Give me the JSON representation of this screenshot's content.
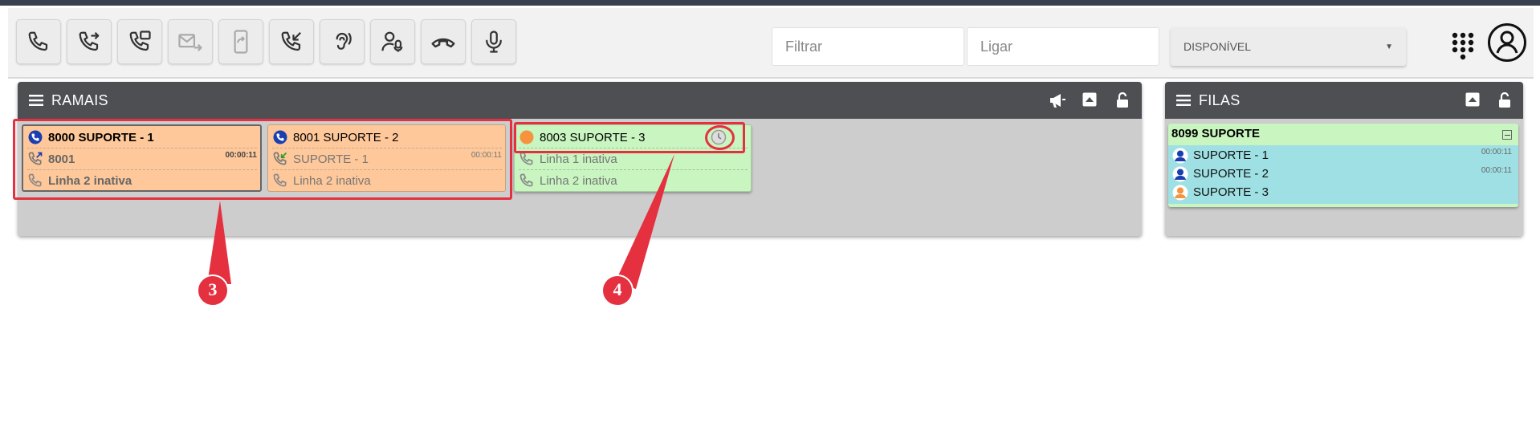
{
  "toolbar": {
    "buttons": [
      {
        "name": "call-button",
        "icon": "phone-icon",
        "state": "enabled"
      },
      {
        "name": "transfer-button",
        "icon": "phone-forward-icon",
        "state": "enabled"
      },
      {
        "name": "attended-transfer-button",
        "icon": "phone-voicemail-icon",
        "state": "enabled"
      },
      {
        "name": "forward-to-email-button",
        "icon": "mail-forward-icon",
        "state": "disabled"
      },
      {
        "name": "forward-to-mobile-button",
        "icon": "mobile-forward-icon",
        "state": "disabled"
      },
      {
        "name": "pickup-button",
        "icon": "phone-incoming-icon",
        "state": "enabled"
      },
      {
        "name": "listen-button",
        "icon": "ear-icon",
        "state": "enabled"
      },
      {
        "name": "whisper-button",
        "icon": "user-voice-icon",
        "state": "enabled"
      },
      {
        "name": "hangup-button",
        "icon": "phone-hangup-icon",
        "state": "enabled"
      },
      {
        "name": "microphone-button",
        "icon": "microphone-icon",
        "state": "enabled"
      }
    ],
    "filter_placeholder": "Filtrar",
    "dial_placeholder": "Ligar",
    "status_value": "DISPONÍVEL"
  },
  "ramais": {
    "title": "RAMAIS",
    "cards": [
      {
        "title": "8000 SUPORTE - 1",
        "status": "on-call",
        "line1": {
          "text": "8001",
          "time": "00:00:11",
          "icon": "phone-outgoing-icon"
        },
        "line2": {
          "text": "Linha 2 inativa",
          "icon": "phone-icon"
        }
      },
      {
        "title": "8001 SUPORTE - 2",
        "status": "on-call",
        "line1": {
          "text": "SUPORTE - 1",
          "time": "00:00:11",
          "icon": "phone-incoming-icon"
        },
        "line2": {
          "text": "Linha 2 inativa",
          "icon": "phone-icon"
        }
      },
      {
        "title": "8003 SUPORTE - 3",
        "status": "paused",
        "line1": {
          "text": "Linha 1 inativa",
          "icon": "phone-icon"
        },
        "line2": {
          "text": "Linha 2 inativa",
          "icon": "phone-icon"
        }
      }
    ]
  },
  "filas": {
    "title": "FILAS",
    "queue": {
      "title": "8099 SUPORTE",
      "members": [
        {
          "name": "SUPORTE - 1",
          "time": "00:00:11",
          "status": "busy"
        },
        {
          "name": "SUPORTE - 2",
          "time": "00:00:11",
          "status": "busy"
        },
        {
          "name": "SUPORTE - 3",
          "time": "",
          "status": "paused"
        }
      ]
    }
  },
  "annotations": {
    "marker_3": "3",
    "marker_4": "4"
  },
  "colors": {
    "busy_card": "#fec89a",
    "free_card": "#c8f5c0",
    "queue_member_row": "#9fe0e4",
    "highlight": "#e53040",
    "panel_header": "#4d4f53"
  }
}
